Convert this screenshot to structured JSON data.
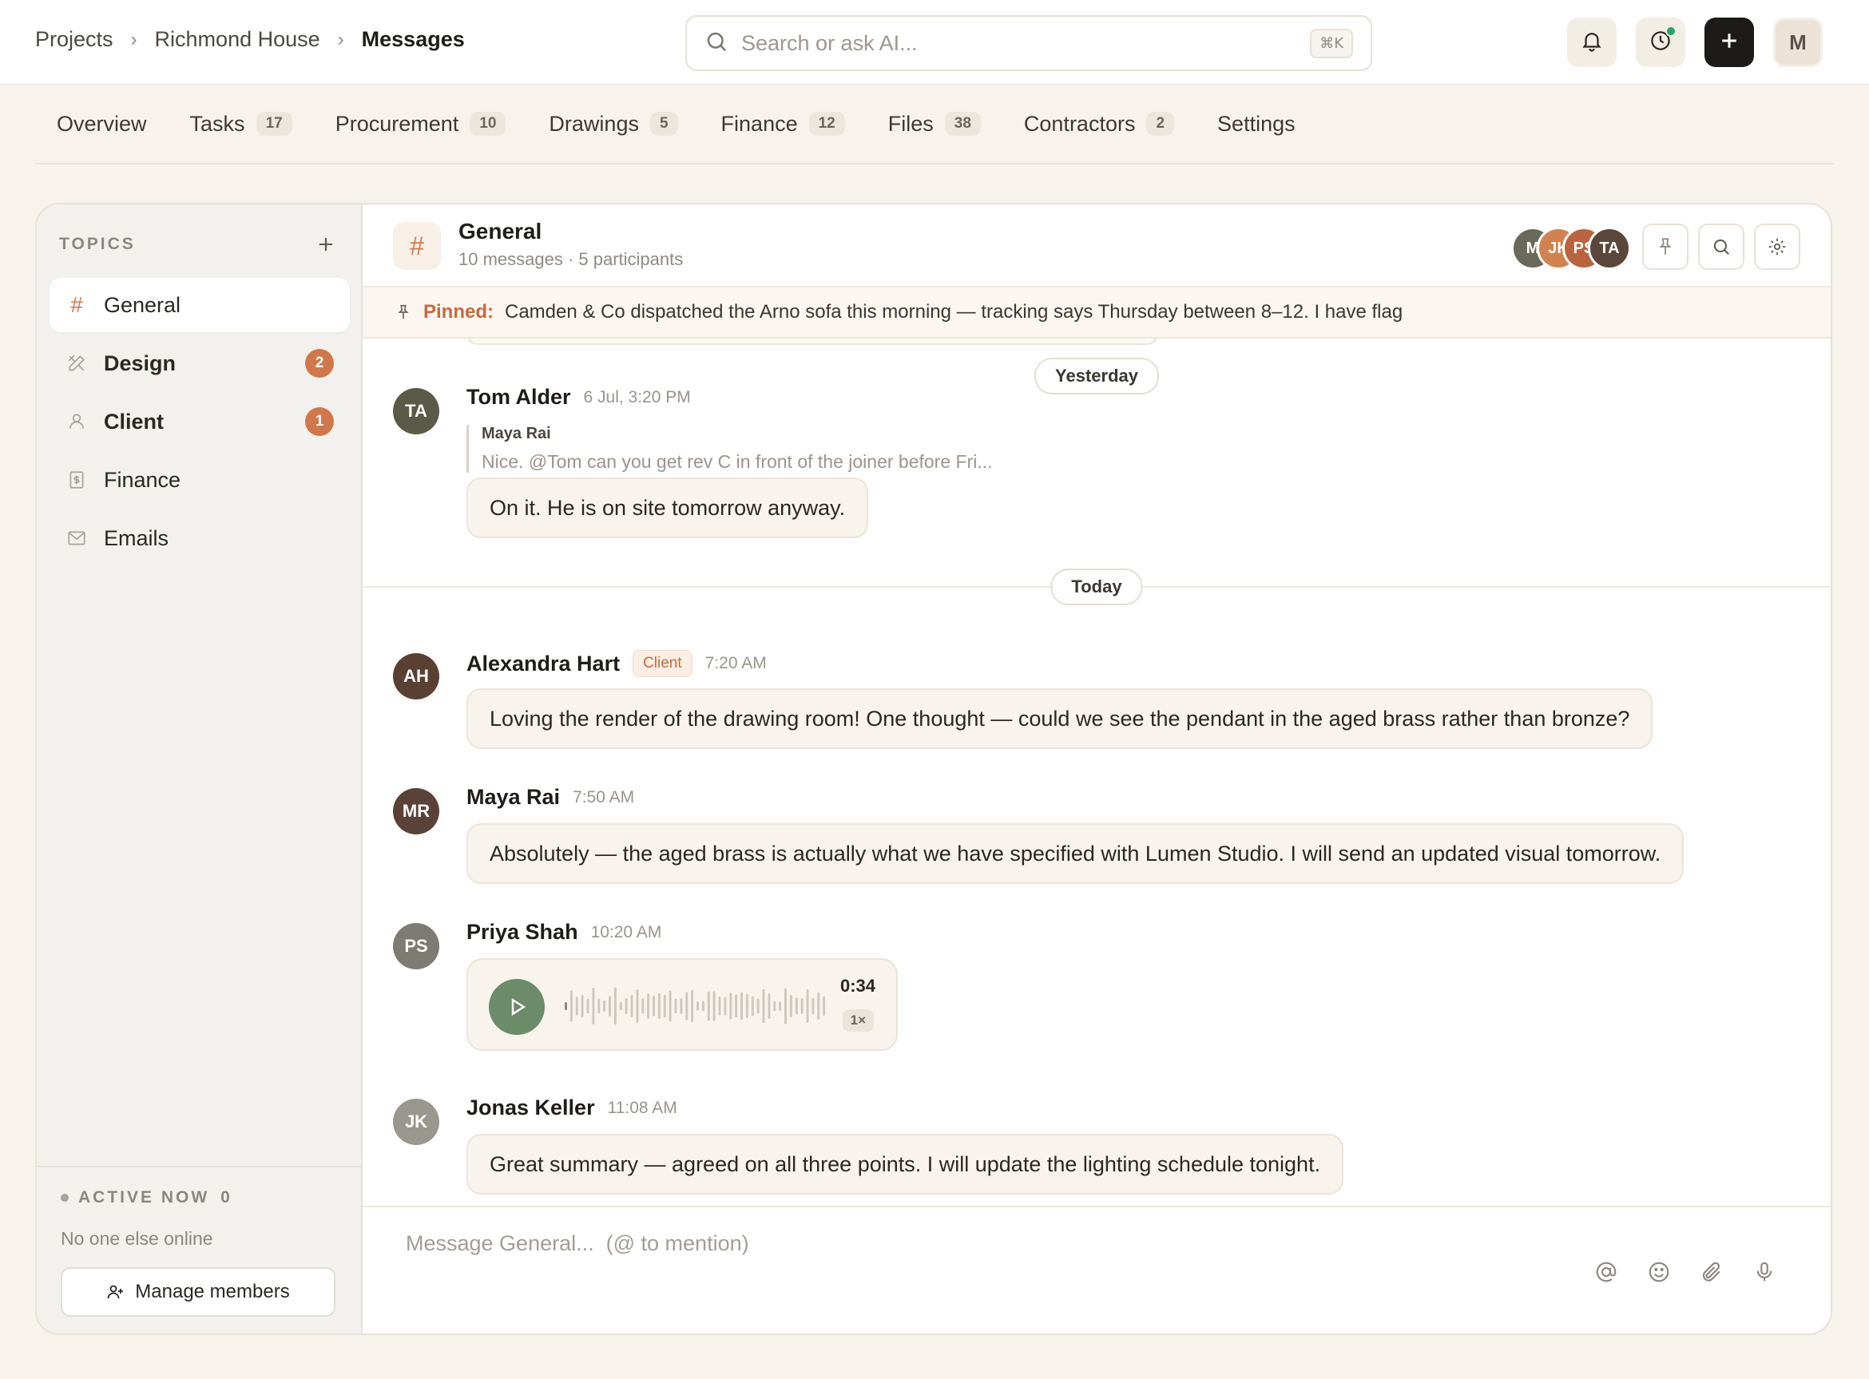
{
  "breadcrumb": {
    "root": "Projects",
    "project": "Richmond House",
    "current": "Messages",
    "separator": "›"
  },
  "search": {
    "placeholder": "Search or ask AI...",
    "shortcut": "⌘K"
  },
  "user": {
    "initial": "M"
  },
  "tabs": [
    {
      "label": "Overview",
      "count": ""
    },
    {
      "label": "Tasks",
      "count": "17"
    },
    {
      "label": "Procurement",
      "count": "10"
    },
    {
      "label": "Drawings",
      "count": "5"
    },
    {
      "label": "Finance",
      "count": "12"
    },
    {
      "label": "Files",
      "count": "38"
    },
    {
      "label": "Contractors",
      "count": "2"
    },
    {
      "label": "Settings",
      "count": ""
    }
  ],
  "sidebar": {
    "title": "TOPICS",
    "topics": [
      {
        "label": "General",
        "unread": "",
        "active": true
      },
      {
        "label": "Design",
        "unread": "2"
      },
      {
        "label": "Client",
        "unread": "1"
      },
      {
        "label": "Finance",
        "unread": ""
      },
      {
        "label": "Emails",
        "unread": ""
      }
    ],
    "active_now": {
      "label": "ACTIVE NOW",
      "count": "0",
      "status": "No one else online"
    },
    "manage_label": "Manage members"
  },
  "channel": {
    "title": "General",
    "subtitle": "10 messages · 5 participants",
    "participants": [
      {
        "initials": "M",
        "color": "#6b6a5a"
      },
      {
        "initials": "JK",
        "color": "#d1834f"
      },
      {
        "initials": "PS",
        "color": "#b9643e"
      },
      {
        "initials": "TA",
        "color": "#5b4739"
      }
    ]
  },
  "pinned": {
    "label": "Pinned:",
    "text": "Camden & Co dispatched the Arno sofa this morning — tracking says Thursday between 8–12. I have flag"
  },
  "days": {
    "yesterday": "Yesterday",
    "today": "Today"
  },
  "messages": {
    "tom": {
      "initials": "TA",
      "author": "Tom Alder",
      "time": "6 Jul, 3:20 PM",
      "reply_to": "Maya Rai",
      "reply_text": "Nice. @Tom can you get rev C in front of the joiner before Fri...",
      "text": "On it. He is on site tomorrow anyway."
    },
    "alexandra": {
      "initials": "AH",
      "author": "Alexandra Hart",
      "role": "Client",
      "time": "7:20 AM",
      "text": "Loving the render of the drawing room! One thought — could we see the pendant in the aged brass rather than bronze?"
    },
    "maya": {
      "initials": "MR",
      "author": "Maya Rai",
      "time": "7:50 AM",
      "text": "Absolutely — the aged brass is actually what we have specified with Lumen Studio. I will send an updated visual tomorrow."
    },
    "priya": {
      "initials": "PS",
      "author": "Priya Shah",
      "time": "10:20 AM",
      "voice": {
        "duration": "0:34",
        "speed": "1×"
      }
    },
    "jonas": {
      "initials": "JK",
      "author": "Jonas Keller",
      "time": "11:08 AM",
      "text": "Great summary — agreed on all three points. I will update the lighting schedule tonight."
    }
  },
  "composer": {
    "placeholder": "Message General...  (@ to mention)"
  },
  "colors": {
    "accent": "#d0784b",
    "online": "#24a36a",
    "voice_play": "#6c8b68",
    "avatar_tom": "#5b5a49",
    "avatar_alexandra": "#5a3f33",
    "avatar_maya": "#5a4238",
    "avatar_priya": "#7e7b74",
    "avatar_jonas": "#9a978f"
  }
}
